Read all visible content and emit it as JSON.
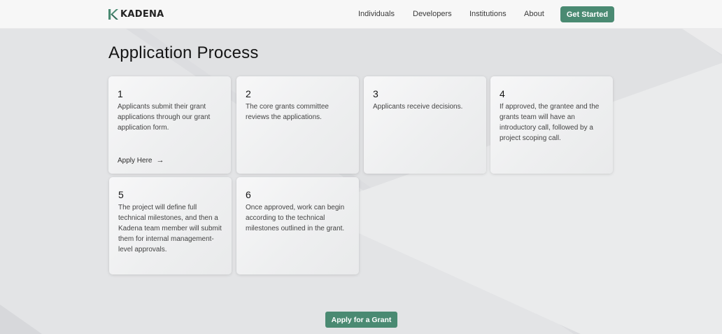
{
  "brand": {
    "name": "KADENA",
    "accent": "#4a8a72"
  },
  "nav": {
    "items": [
      {
        "label": "Individuals"
      },
      {
        "label": "Developers"
      },
      {
        "label": "Institutions"
      },
      {
        "label": "About"
      }
    ],
    "cta_label": "Get Started"
  },
  "page": {
    "title": "Application Process"
  },
  "cards": [
    {
      "number": "1",
      "text": "Applicants submit their grant applications through our grant application form.",
      "link_label": "Apply Here",
      "link_icon": "arrow-right-icon"
    },
    {
      "number": "2",
      "text": "The core grants committee reviews the applications."
    },
    {
      "number": "3",
      "text": "Applicants receive decisions."
    },
    {
      "number": "4",
      "text": "If approved, the grantee and the grants team will have an introductory call, followed by a project scoping call."
    },
    {
      "number": "5",
      "text": "The project will define full technical milestones, and then a Kadena team member will submit them for internal management-level approvals."
    },
    {
      "number": "6",
      "text": "Once approved, work can begin according to the technical milestones outlined in the grant."
    }
  ],
  "footer_cta": {
    "label": "Apply for a Grant"
  }
}
